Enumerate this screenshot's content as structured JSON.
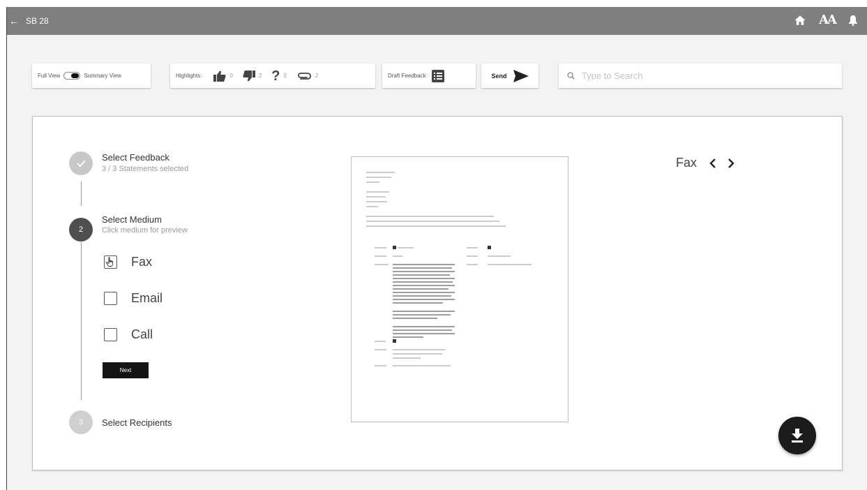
{
  "header": {
    "back_icon": "arrow-left-icon",
    "title": "SB 28",
    "font_size_label": "AA",
    "icons": [
      "home-icon",
      "font-size-icon",
      "bell-icon"
    ]
  },
  "toolbar": {
    "view_toggle": {
      "left_label": "Full View",
      "right_label": "Summary View",
      "selected": "Summary View"
    },
    "highlights": {
      "label": "Highlights:",
      "items": [
        {
          "icon": "thumbs-up-icon",
          "count": "0"
        },
        {
          "icon": "thumbs-down-icon",
          "count": "2"
        },
        {
          "icon": "question-icon",
          "count": "0"
        },
        {
          "icon": "paperclip-icon",
          "count": "2"
        }
      ]
    },
    "draft_feedback_label": "Draft Feedback",
    "send_label": "Send",
    "search_placeholder": "Type to Search"
  },
  "steps": [
    {
      "number": "",
      "status": "complete",
      "title": "Select Feedback",
      "subtitle": "3 / 3 Statements selected"
    },
    {
      "number": "2",
      "status": "active",
      "title": "Select Medium",
      "subtitle": "Click medium for preview"
    },
    {
      "number": "3",
      "status": "pending",
      "title": "Select Recipients",
      "subtitle": ""
    }
  ],
  "mediums": [
    {
      "label": "Fax",
      "checked": false,
      "hovered": true
    },
    {
      "label": "Email",
      "checked": false,
      "hovered": false
    },
    {
      "label": "Call",
      "checked": false,
      "hovered": false
    }
  ],
  "next_label": "Next",
  "preview_nav": {
    "medium": "Fax",
    "prev_icon": "chevron-left-icon",
    "next_icon": "chevron-right-icon"
  },
  "fab_icon": "download-icon",
  "colors": {
    "topbar": "#7f7f7f",
    "step_done": "#c8c8c8",
    "step_active": "#4f4f4f",
    "step_pending": "#cfcfcf",
    "button_dark": "#141414"
  }
}
